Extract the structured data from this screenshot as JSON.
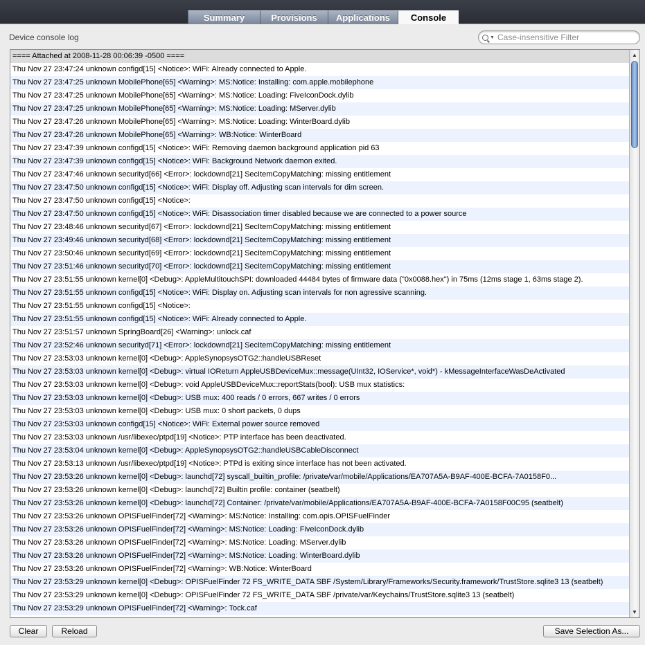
{
  "tabs": [
    {
      "label": "Summary",
      "active": false
    },
    {
      "label": "Provisions",
      "active": false
    },
    {
      "label": "Applications",
      "active": false
    },
    {
      "label": "Console",
      "active": true
    }
  ],
  "panel": {
    "title": "Device console log"
  },
  "filter": {
    "placeholder": "Case-insensitive Filter",
    "value": ""
  },
  "log": {
    "header": "==== Attached at 2008-11-28 00:06:39 -0500 ====",
    "lines": [
      "Thu Nov 27 23:47:24 unknown configd[15] <Notice>: WiFi: Already connected to Apple.",
      "Thu Nov 27 23:47:25 unknown MobilePhone[65] <Warning>: MS:Notice: Installing: com.apple.mobilephone",
      "Thu Nov 27 23:47:25 unknown MobilePhone[65] <Warning>: MS:Notice: Loading: FiveIconDock.dylib",
      "Thu Nov 27 23:47:25 unknown MobilePhone[65] <Warning>: MS:Notice: Loading: MServer.dylib",
      "Thu Nov 27 23:47:26 unknown MobilePhone[65] <Warning>: MS:Notice: Loading: WinterBoard.dylib",
      "Thu Nov 27 23:47:26 unknown MobilePhone[65] <Warning>: WB:Notice: WinterBoard",
      "Thu Nov 27 23:47:39 unknown configd[15] <Notice>: WiFi: Removing daemon background application pid 63",
      "Thu Nov 27 23:47:39 unknown configd[15] <Notice>: WiFi: Background Network daemon exited.",
      "Thu Nov 27 23:47:46 unknown securityd[66] <Error>: lockdownd[21] SecItemCopyMatching: missing entitlement",
      "Thu Nov 27 23:47:50 unknown configd[15] <Notice>: WiFi: Display off.  Adjusting scan intervals for dim screen.",
      "Thu Nov 27 23:47:50 unknown configd[15] <Notice>:",
      "Thu Nov 27 23:47:50 unknown configd[15] <Notice>: WiFi: Disassociation timer disabled because we are connected to a power source",
      "Thu Nov 27 23:48:46 unknown securityd[67] <Error>: lockdownd[21] SecItemCopyMatching: missing entitlement",
      "Thu Nov 27 23:49:46 unknown securityd[68] <Error>: lockdownd[21] SecItemCopyMatching: missing entitlement",
      "Thu Nov 27 23:50:46 unknown securityd[69] <Error>: lockdownd[21] SecItemCopyMatching: missing entitlement",
      "Thu Nov 27 23:51:46 unknown securityd[70] <Error>: lockdownd[21] SecItemCopyMatching: missing entitlement",
      "Thu Nov 27 23:51:55 unknown kernel[0] <Debug>: AppleMultitouchSPI: downloaded 44484 bytes of firmware data (\"0x0088.hex\") in 75ms (12ms stage 1, 63ms stage 2).",
      "Thu Nov 27 23:51:55 unknown configd[15] <Notice>: WiFi: Display on.  Adjusting scan intervals for non agressive scanning.",
      "Thu Nov 27 23:51:55 unknown configd[15] <Notice>:",
      "Thu Nov 27 23:51:55 unknown configd[15] <Notice>: WiFi: Already connected to Apple.",
      "Thu Nov 27 23:51:57 unknown SpringBoard[26] <Warning>: unlock.caf",
      "Thu Nov 27 23:52:46 unknown securityd[71] <Error>: lockdownd[21] SecItemCopyMatching: missing entitlement",
      "Thu Nov 27 23:53:03 unknown kernel[0] <Debug>: AppleSynopsysOTG2::handleUSBReset",
      "Thu Nov 27 23:53:03 unknown kernel[0] <Debug>: virtual IOReturn AppleUSBDeviceMux::message(UInt32, IOService*, void*) - kMessageInterfaceWasDeActivated",
      "Thu Nov 27 23:53:03 unknown kernel[0] <Debug>: void AppleUSBDeviceMux::reportStats(bool): USB mux statistics:",
      "Thu Nov 27 23:53:03 unknown kernel[0] <Debug>: USB mux: 400 reads / 0 errors, 667 writes / 0 errors",
      "Thu Nov 27 23:53:03 unknown kernel[0] <Debug>: USB mux: 0 short packets, 0 dups",
      "Thu Nov 27 23:53:03 unknown configd[15] <Notice>: WiFi: External power source removed",
      "Thu Nov 27 23:53:03 unknown /usr/libexec/ptpd[19] <Notice>: PTP interface has been deactivated.",
      "Thu Nov 27 23:53:04 unknown kernel[0] <Debug>: AppleSynopsysOTG2::handleUSBCableDisconnect",
      "Thu Nov 27 23:53:13 unknown /usr/libexec/ptpd[19] <Notice>: PTPd is exiting since interface has not been activated.",
      "Thu Nov 27 23:53:26 unknown kernel[0] <Debug>: launchd[72] syscall_builtin_profile: /private/var/mobile/Applications/EA707A5A-B9AF-400E-BCFA-7A0158F0...",
      "Thu Nov 27 23:53:26 unknown kernel[0] <Debug>: launchd[72] Builtin profile: container (seatbelt)",
      "Thu Nov 27 23:53:26 unknown kernel[0] <Debug>: launchd[72] Container: /private/var/mobile/Applications/EA707A5A-B9AF-400E-BCFA-7A0158F00C95 (seatbelt)",
      "Thu Nov 27 23:53:26 unknown OPISFuelFinder[72] <Warning>: MS:Notice: Installing: com.opis.OPISFuelFinder",
      "Thu Nov 27 23:53:26 unknown OPISFuelFinder[72] <Warning>: MS:Notice: Loading: FiveIconDock.dylib",
      "Thu Nov 27 23:53:26 unknown OPISFuelFinder[72] <Warning>: MS:Notice: Loading: MServer.dylib",
      "Thu Nov 27 23:53:26 unknown OPISFuelFinder[72] <Warning>: MS:Notice: Loading: WinterBoard.dylib",
      "Thu Nov 27 23:53:26 unknown OPISFuelFinder[72] <Warning>: WB:Notice: WinterBoard",
      "Thu Nov 27 23:53:29 unknown kernel[0] <Debug>: OPISFuelFinder 72 FS_WRITE_DATA SBF /System/Library/Frameworks/Security.framework/TrustStore.sqlite3 13 (seatbelt)",
      "Thu Nov 27 23:53:29 unknown kernel[0] <Debug>: OPISFuelFinder 72 FS_WRITE_DATA SBF /private/var/Keychains/TrustStore.sqlite3 13 (seatbelt)",
      "Thu Nov 27 23:53:29 unknown OPISFuelFinder[72] <Warning>: Tock.caf"
    ]
  },
  "buttons": {
    "clear": "Clear",
    "reload": "Reload",
    "save": "Save Selection As..."
  },
  "icons": {
    "filter": "search-icon",
    "scroll_up": "arrow-up-icon",
    "scroll_down": "arrow-down-icon"
  }
}
